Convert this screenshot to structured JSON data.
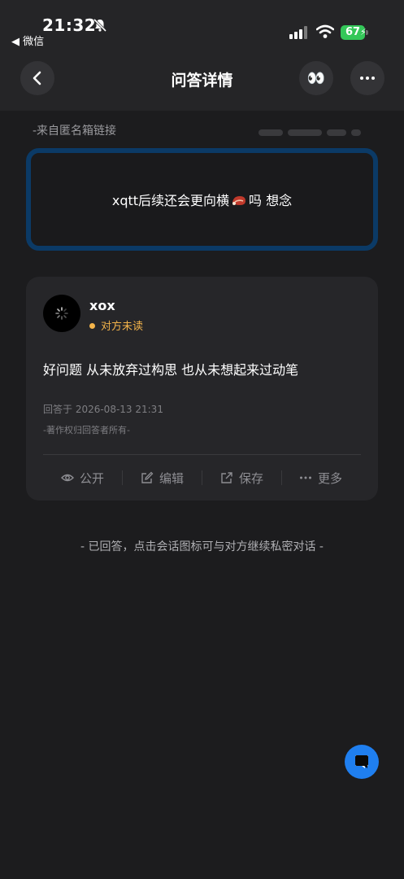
{
  "status_bar": {
    "time": "21:32",
    "back_app": "◀ 微信",
    "battery": "67"
  },
  "header": {
    "title": "问答详情",
    "eyes_emoji": "👀"
  },
  "source_label": "-来自匿名箱链接",
  "question": {
    "text_before": "xqtt后续还会更向横",
    "text_after": "吗 想念"
  },
  "answer": {
    "user_name": "xox",
    "status": "对方未读",
    "text": "好问题 从未放弃过构思 也从未想起来过动笔",
    "answered_at": "回答于 2026-08-13 21:31",
    "copyright": "-著作权归回答者所有-"
  },
  "actions": [
    {
      "label": "公开",
      "icon": "eye-icon"
    },
    {
      "label": "编辑",
      "icon": "edit-icon"
    },
    {
      "label": "保存",
      "icon": "share-icon"
    },
    {
      "label": "更多",
      "icon": "more-icon"
    }
  ],
  "footer_note": "- 已回答，点击会话图标可与对方继续私密对话 -",
  "colors": {
    "accent_blue": "#1f7ff0",
    "unread_orange": "#f4b44a",
    "battery_green": "#34c759",
    "question_border": "#0b3a66"
  }
}
